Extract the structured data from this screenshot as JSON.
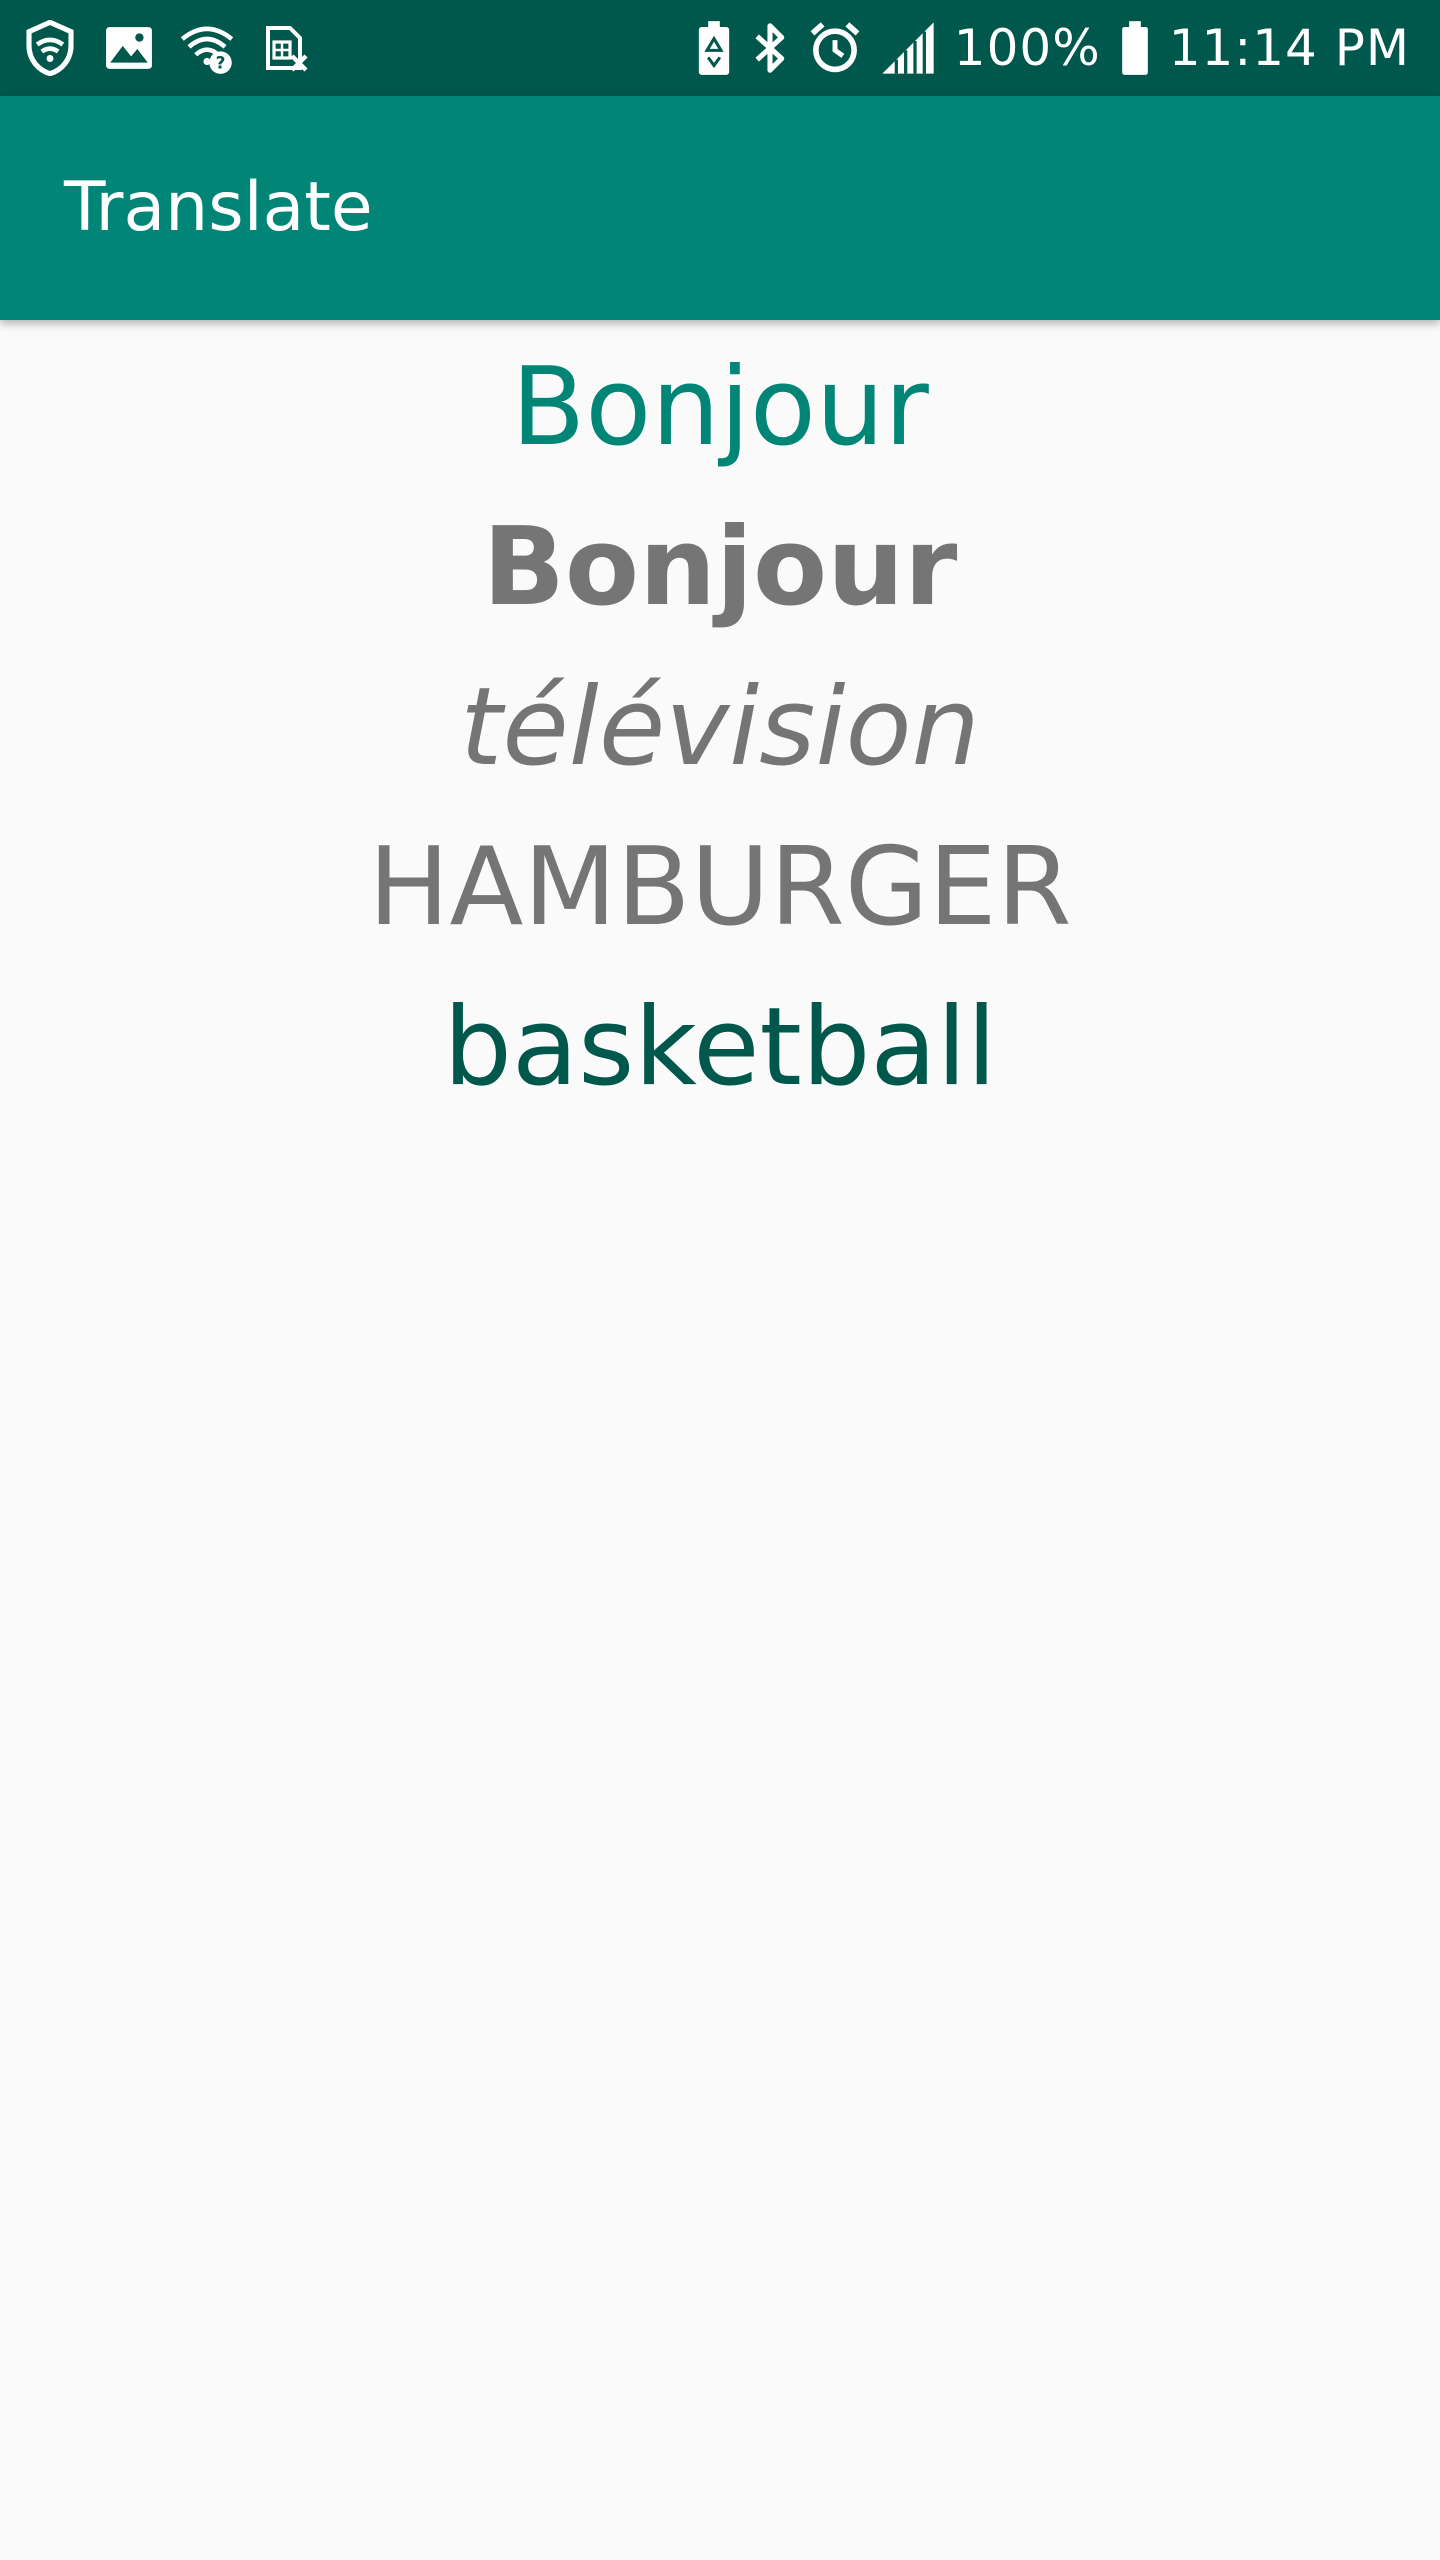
{
  "status_bar": {
    "battery_percent": "100%",
    "time": "11:14 PM",
    "icons": [
      "shield-icon",
      "image-icon",
      "wifi-question-icon",
      "sim-error-icon",
      "battery-saver-icon",
      "bluetooth-icon",
      "alarm-icon",
      "signal-icon",
      "battery-icon"
    ],
    "background_color": "#00574b"
  },
  "app_bar": {
    "title": "Translate",
    "background_color": "#008577"
  },
  "words": [
    {
      "text": "Bonjour",
      "color": "#008577",
      "style": "normal"
    },
    {
      "text": "Bonjour",
      "color": "#757575",
      "style": "bold"
    },
    {
      "text": "télévision",
      "color": "#757575",
      "style": "italic"
    },
    {
      "text": "HAMBURGER",
      "color": "#757575",
      "style": "normal"
    },
    {
      "text": "basketball",
      "color": "#00574b",
      "style": "normal"
    }
  ]
}
